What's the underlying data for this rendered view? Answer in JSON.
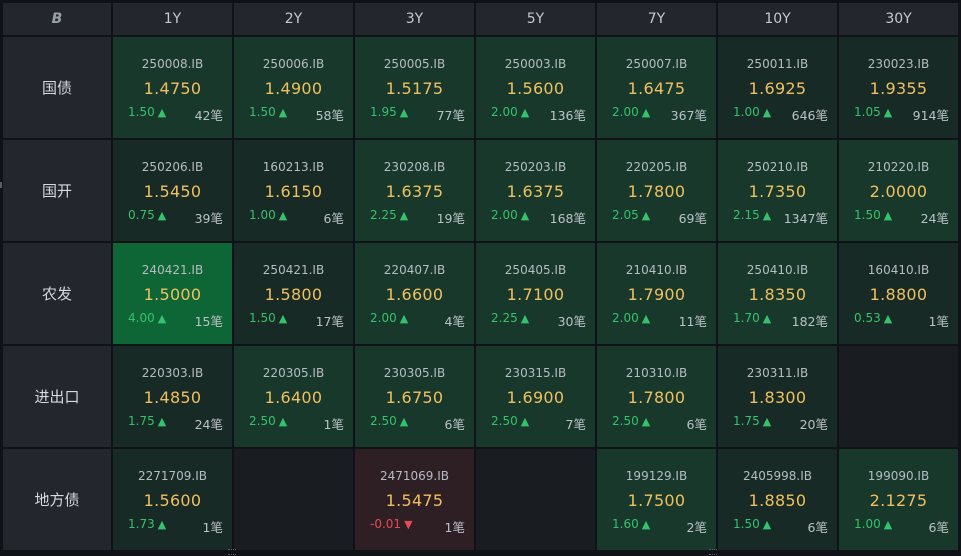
{
  "corner_logo": "B",
  "tenors": [
    "1Y",
    "2Y",
    "3Y",
    "5Y",
    "7Y",
    "10Y",
    "30Y"
  ],
  "rows": [
    {
      "label": "国债",
      "cells": [
        {
          "code": "250008.IB",
          "price": "1.4750",
          "chg": "1.50",
          "dir": "up",
          "count": "42笔",
          "tone": "mid"
        },
        {
          "code": "250006.IB",
          "price": "1.4900",
          "chg": "1.50",
          "dir": "up",
          "count": "58笔",
          "tone": "mid"
        },
        {
          "code": "250005.IB",
          "price": "1.5175",
          "chg": "1.95",
          "dir": "up",
          "count": "77笔",
          "tone": "mid"
        },
        {
          "code": "250003.IB",
          "price": "1.5600",
          "chg": "2.00",
          "dir": "up",
          "count": "136笔",
          "tone": "mid"
        },
        {
          "code": "250007.IB",
          "price": "1.6475",
          "chg": "2.00",
          "dir": "up",
          "count": "367笔",
          "tone": "mid"
        },
        {
          "code": "250011.IB",
          "price": "1.6925",
          "chg": "1.00",
          "dir": "up",
          "count": "646笔",
          "tone": "dim"
        },
        {
          "code": "230023.IB",
          "price": "1.9355",
          "chg": "1.05",
          "dir": "up",
          "count": "914笔",
          "tone": "dim"
        }
      ]
    },
    {
      "label": "国开",
      "cells": [
        {
          "code": "250206.IB",
          "price": "1.5450",
          "chg": "0.75",
          "dir": "up",
          "count": "39笔",
          "tone": "dim"
        },
        {
          "code": "160213.IB",
          "price": "1.6150",
          "chg": "1.00",
          "dir": "up",
          "count": "6笔",
          "tone": "dim"
        },
        {
          "code": "230208.IB",
          "price": "1.6375",
          "chg": "2.25",
          "dir": "up",
          "count": "19笔",
          "tone": "mid"
        },
        {
          "code": "250203.IB",
          "price": "1.6375",
          "chg": "2.00",
          "dir": "up",
          "count": "168笔",
          "tone": "mid"
        },
        {
          "code": "220205.IB",
          "price": "1.7800",
          "chg": "2.05",
          "dir": "up",
          "count": "69笔",
          "tone": "mid"
        },
        {
          "code": "250210.IB",
          "price": "1.7350",
          "chg": "2.15",
          "dir": "up",
          "count": "1347笔",
          "tone": "mid"
        },
        {
          "code": "210220.IB",
          "price": "2.0000",
          "chg": "1.50",
          "dir": "up",
          "count": "24笔",
          "tone": "mid"
        }
      ]
    },
    {
      "label": "农发",
      "cells": [
        {
          "code": "240421.IB",
          "price": "1.5000",
          "chg": "4.00",
          "dir": "up",
          "count": "15笔",
          "tone": "bright"
        },
        {
          "code": "250421.IB",
          "price": "1.5800",
          "chg": "1.50",
          "dir": "up",
          "count": "17笔",
          "tone": "dim"
        },
        {
          "code": "220407.IB",
          "price": "1.6600",
          "chg": "2.00",
          "dir": "up",
          "count": "4笔",
          "tone": "mid"
        },
        {
          "code": "250405.IB",
          "price": "1.7100",
          "chg": "2.25",
          "dir": "up",
          "count": "30笔",
          "tone": "mid"
        },
        {
          "code": "210410.IB",
          "price": "1.7900",
          "chg": "2.00",
          "dir": "up",
          "count": "11笔",
          "tone": "mid"
        },
        {
          "code": "250410.IB",
          "price": "1.8350",
          "chg": "1.70",
          "dir": "up",
          "count": "182笔",
          "tone": "mid"
        },
        {
          "code": "160410.IB",
          "price": "1.8800",
          "chg": "0.53",
          "dir": "up",
          "count": "1笔",
          "tone": "dim"
        }
      ]
    },
    {
      "label": "进出口",
      "cells": [
        {
          "code": "220303.IB",
          "price": "1.4850",
          "chg": "1.75",
          "dir": "up",
          "count": "24笔",
          "tone": "dim"
        },
        {
          "code": "220305.IB",
          "price": "1.6400",
          "chg": "2.50",
          "dir": "up",
          "count": "1笔",
          "tone": "mid"
        },
        {
          "code": "230305.IB",
          "price": "1.6750",
          "chg": "2.50",
          "dir": "up",
          "count": "6笔",
          "tone": "mid"
        },
        {
          "code": "230315.IB",
          "price": "1.6900",
          "chg": "2.50",
          "dir": "up",
          "count": "7笔",
          "tone": "mid"
        },
        {
          "code": "210310.IB",
          "price": "1.7800",
          "chg": "2.50",
          "dir": "up",
          "count": "6笔",
          "tone": "mid"
        },
        {
          "code": "230311.IB",
          "price": "1.8300",
          "chg": "1.75",
          "dir": "up",
          "count": "20笔",
          "tone": "dim"
        },
        null
      ]
    },
    {
      "label": "地方债",
      "cells": [
        {
          "code": "2271709.IB",
          "price": "1.5600",
          "chg": "1.73",
          "dir": "up",
          "count": "1笔",
          "tone": "dim"
        },
        null,
        {
          "code": "2471069.IB",
          "price": "1.5475",
          "chg": "-0.01",
          "dir": "down",
          "count": "1笔",
          "tone": "red"
        },
        null,
        {
          "code": "199129.IB",
          "price": "1.7500",
          "chg": "1.60",
          "dir": "up",
          "count": "2笔",
          "tone": "mid"
        },
        {
          "code": "2405998.IB",
          "price": "1.8850",
          "chg": "1.50",
          "dir": "up",
          "count": "6笔",
          "tone": "dim"
        },
        {
          "code": "199090.IB",
          "price": "2.1275",
          "chg": "1.00",
          "dir": "up",
          "count": "6笔",
          "tone": "mid"
        }
      ]
    }
  ],
  "arrows": {
    "up": "▲",
    "down": "▼"
  },
  "colors": {
    "up": "#35c26c",
    "down": "#e84a55",
    "price": "#f0c060",
    "bright_cell": "#0e6536",
    "red_cell": "#2e1f24"
  }
}
